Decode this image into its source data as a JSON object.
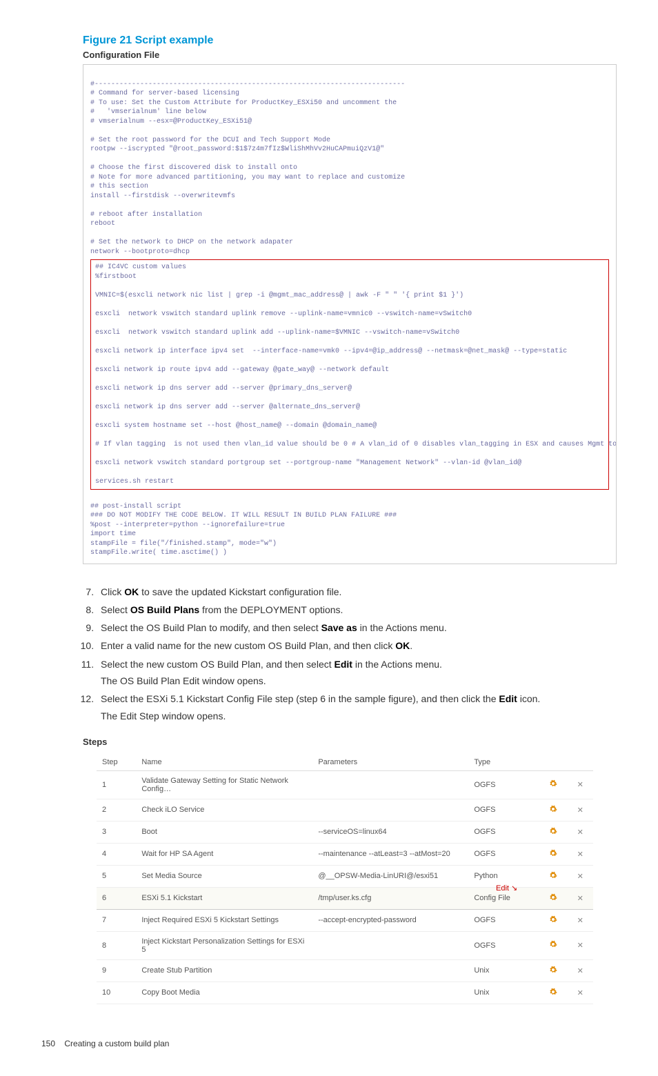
{
  "figure_title": "Figure 21 Script example",
  "config_file_label": "Configuration File",
  "script_text_top": "#---------------------------------------------------------------------------\n# Command for server-based licensing\n# To use: Set the Custom Attribute for ProductKey_ESXi50 and uncomment the\n#   'vmserialnum' line below\n# vmserialnum --esx=@ProductKey_ESXi51@\n\n# Set the root password for the DCUI and Tech Support Mode\nrootpw --iscrypted \"@root_password:$1$7z4m7fIz$WliShMhVv2HuCAPmuiQzV1@\"\n\n# Choose the first discovered disk to install onto\n# Note for more advanced partitioning, you may want to replace and customize\n# this section\ninstall --firstdisk --overwritevmfs\n\n# reboot after installation\nreboot\n\n# Set the network to DHCP on the network adapater\nnetwork --bootproto=dhcp",
  "script_text_highlight": "## IC4VC custom values\n%firstboot\n\nVMNIC=$(esxcli network nic list | grep -i @mgmt_mac_address@ | awk -F \" \" '{ print $1 }')\n\nesxcli  network vswitch standard uplink remove --uplink-name=vmnic0 --vswitch-name=vSwitch0\n\nesxcli  network vswitch standard uplink add --uplink-name=$VMNIC --vswitch-name=vSwitch0\n\nesxcli network ip interface ipv4 set  --interface-name=vmk0 --ipv4=@ip_address@ --netmask=@net_mask@ --type=static\n\nesxcli network ip route ipv4 add --gateway @gate_way@ --network default\n\nesxcli network ip dns server add --server @primary_dns_server@\n\nesxcli network ip dns server add --server @alternate_dns_server@\n\nesxcli system hostname set --host @host_name@ --domain @domain_name@\n\n# If vlan tagging  is not used then vlan_id value should be 0 # A vlan_id of 0 disables vlan_tagging in ESX and causes Mgmt to use interface of vswitch\n\nesxcli network vswitch standard portgroup set --portgroup-name \"Management Network\" --vlan-id @vlan_id@\n\nservices.sh restart",
  "script_text_bottom": "## post-install script\n### DO NOT MODIFY THE CODE BELOW. IT WILL RESULT IN BUILD PLAN FAILURE ###\n%post --interpreter=python --ignorefailure=true\nimport time\nstampFile = file(\"/finished.stamp\", mode=\"w\")\nstampFile.write( time.asctime() )",
  "instructions": [
    {
      "num": "7",
      "html": "Click <b>OK</b> to save the updated Kickstart configuration file."
    },
    {
      "num": "8",
      "html": "Select <b>OS Build Plans</b> from the DEPLOYMENT options."
    },
    {
      "num": "9",
      "html": "Select the OS Build Plan to modify, and then select <b>Save as</b> in the Actions menu."
    },
    {
      "num": "10",
      "html": "Enter a valid name for the new custom OS Build Plan, and then click <b>OK</b>."
    },
    {
      "num": "11",
      "html": "Select the new custom OS Build Plan, and then select <b>Edit</b> in the Actions menu.",
      "sub": "The OS Build Plan Edit window opens."
    },
    {
      "num": "12",
      "html": "Select the ESXi 5.1 Kickstart Config File step (step 6 in the sample figure), and then click the <b>Edit</b> icon.",
      "sub": "The Edit Step window opens."
    }
  ],
  "steps_label": "Steps",
  "steps_header": {
    "step": "Step",
    "name": "Name",
    "parameters": "Parameters",
    "type": "Type"
  },
  "edit_callout": "Edit",
  "steps": [
    {
      "step": "1",
      "name": "Validate Gateway Setting for Static Network Config…",
      "parameters": "",
      "type": "OGFS"
    },
    {
      "step": "2",
      "name": "Check iLO Service",
      "parameters": "",
      "type": "OGFS"
    },
    {
      "step": "3",
      "name": "Boot",
      "parameters": "--serviceOS=linux64",
      "type": "OGFS"
    },
    {
      "step": "4",
      "name": "Wait for HP SA Agent",
      "parameters": "--maintenance --atLeast=3 --atMost=20",
      "type": "OGFS"
    },
    {
      "step": "5",
      "name": "Set Media Source",
      "parameters": "@__OPSW-Media-LinURI@/esxi51",
      "type": "Python"
    },
    {
      "step": "6",
      "name": "ESXi 5.1 Kickstart",
      "parameters": "/tmp/user.ks.cfg",
      "type": "Config File",
      "highlight": true,
      "callout": true
    },
    {
      "step": "7",
      "name": "Inject Required ESXi 5 Kickstart Settings",
      "parameters": "--accept-encrypted-password",
      "type": "OGFS"
    },
    {
      "step": "8",
      "name": "Inject Kickstart Personalization Settings for ESXi 5",
      "parameters": "",
      "type": "OGFS"
    },
    {
      "step": "9",
      "name": "Create Stub Partition",
      "parameters": "",
      "type": "Unix"
    },
    {
      "step": "10",
      "name": "Copy Boot Media",
      "parameters": "",
      "type": "Unix"
    }
  ],
  "footer": {
    "page": "150",
    "text": "Creating a custom build plan"
  }
}
